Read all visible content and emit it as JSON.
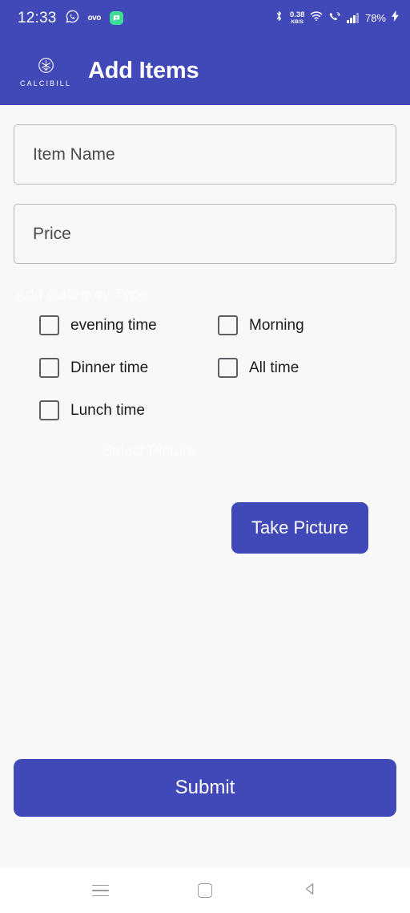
{
  "status_bar": {
    "clock": "12:33",
    "notification_icons": [
      "whatsapp-icon",
      "ovo-icon",
      "chat-bubble-icon"
    ],
    "ovo_label": "ovo",
    "data_rate_value": "0.38",
    "data_rate_unit": "KB/S",
    "system_icons": [
      "bluetooth-icon",
      "wifi-icon",
      "wifi-calling-icon",
      "signal-bars-icon"
    ],
    "battery_text": "78%",
    "charging": true,
    "background_color": "#4149b8"
  },
  "app_bar": {
    "brand_name": "CALCIBILL",
    "brand_mark": "asterisk-circle-logo",
    "title": "Add Items",
    "background_color": "#4149b8"
  },
  "form": {
    "item_name_field": {
      "placeholder": "Item Name",
      "value": ""
    },
    "price_field": {
      "placeholder": "Price",
      "value": ""
    },
    "category_hint": "Add Category Type",
    "picture_hint": "Select Picture",
    "checkboxes": [
      {
        "label": "evening time",
        "checked": false
      },
      {
        "label": "Morning",
        "checked": false
      },
      {
        "label": "Dinner time",
        "checked": false
      },
      {
        "label": "All time",
        "checked": false
      },
      {
        "label": "Lunch time",
        "checked": false
      }
    ],
    "take_picture_label": "Take Picture",
    "submit_label": "Submit",
    "accent_color": "#4149b8"
  },
  "nav_bar": {
    "buttons": [
      "recents-icon",
      "home-icon",
      "back-icon"
    ],
    "background_color": "#ffffff"
  }
}
